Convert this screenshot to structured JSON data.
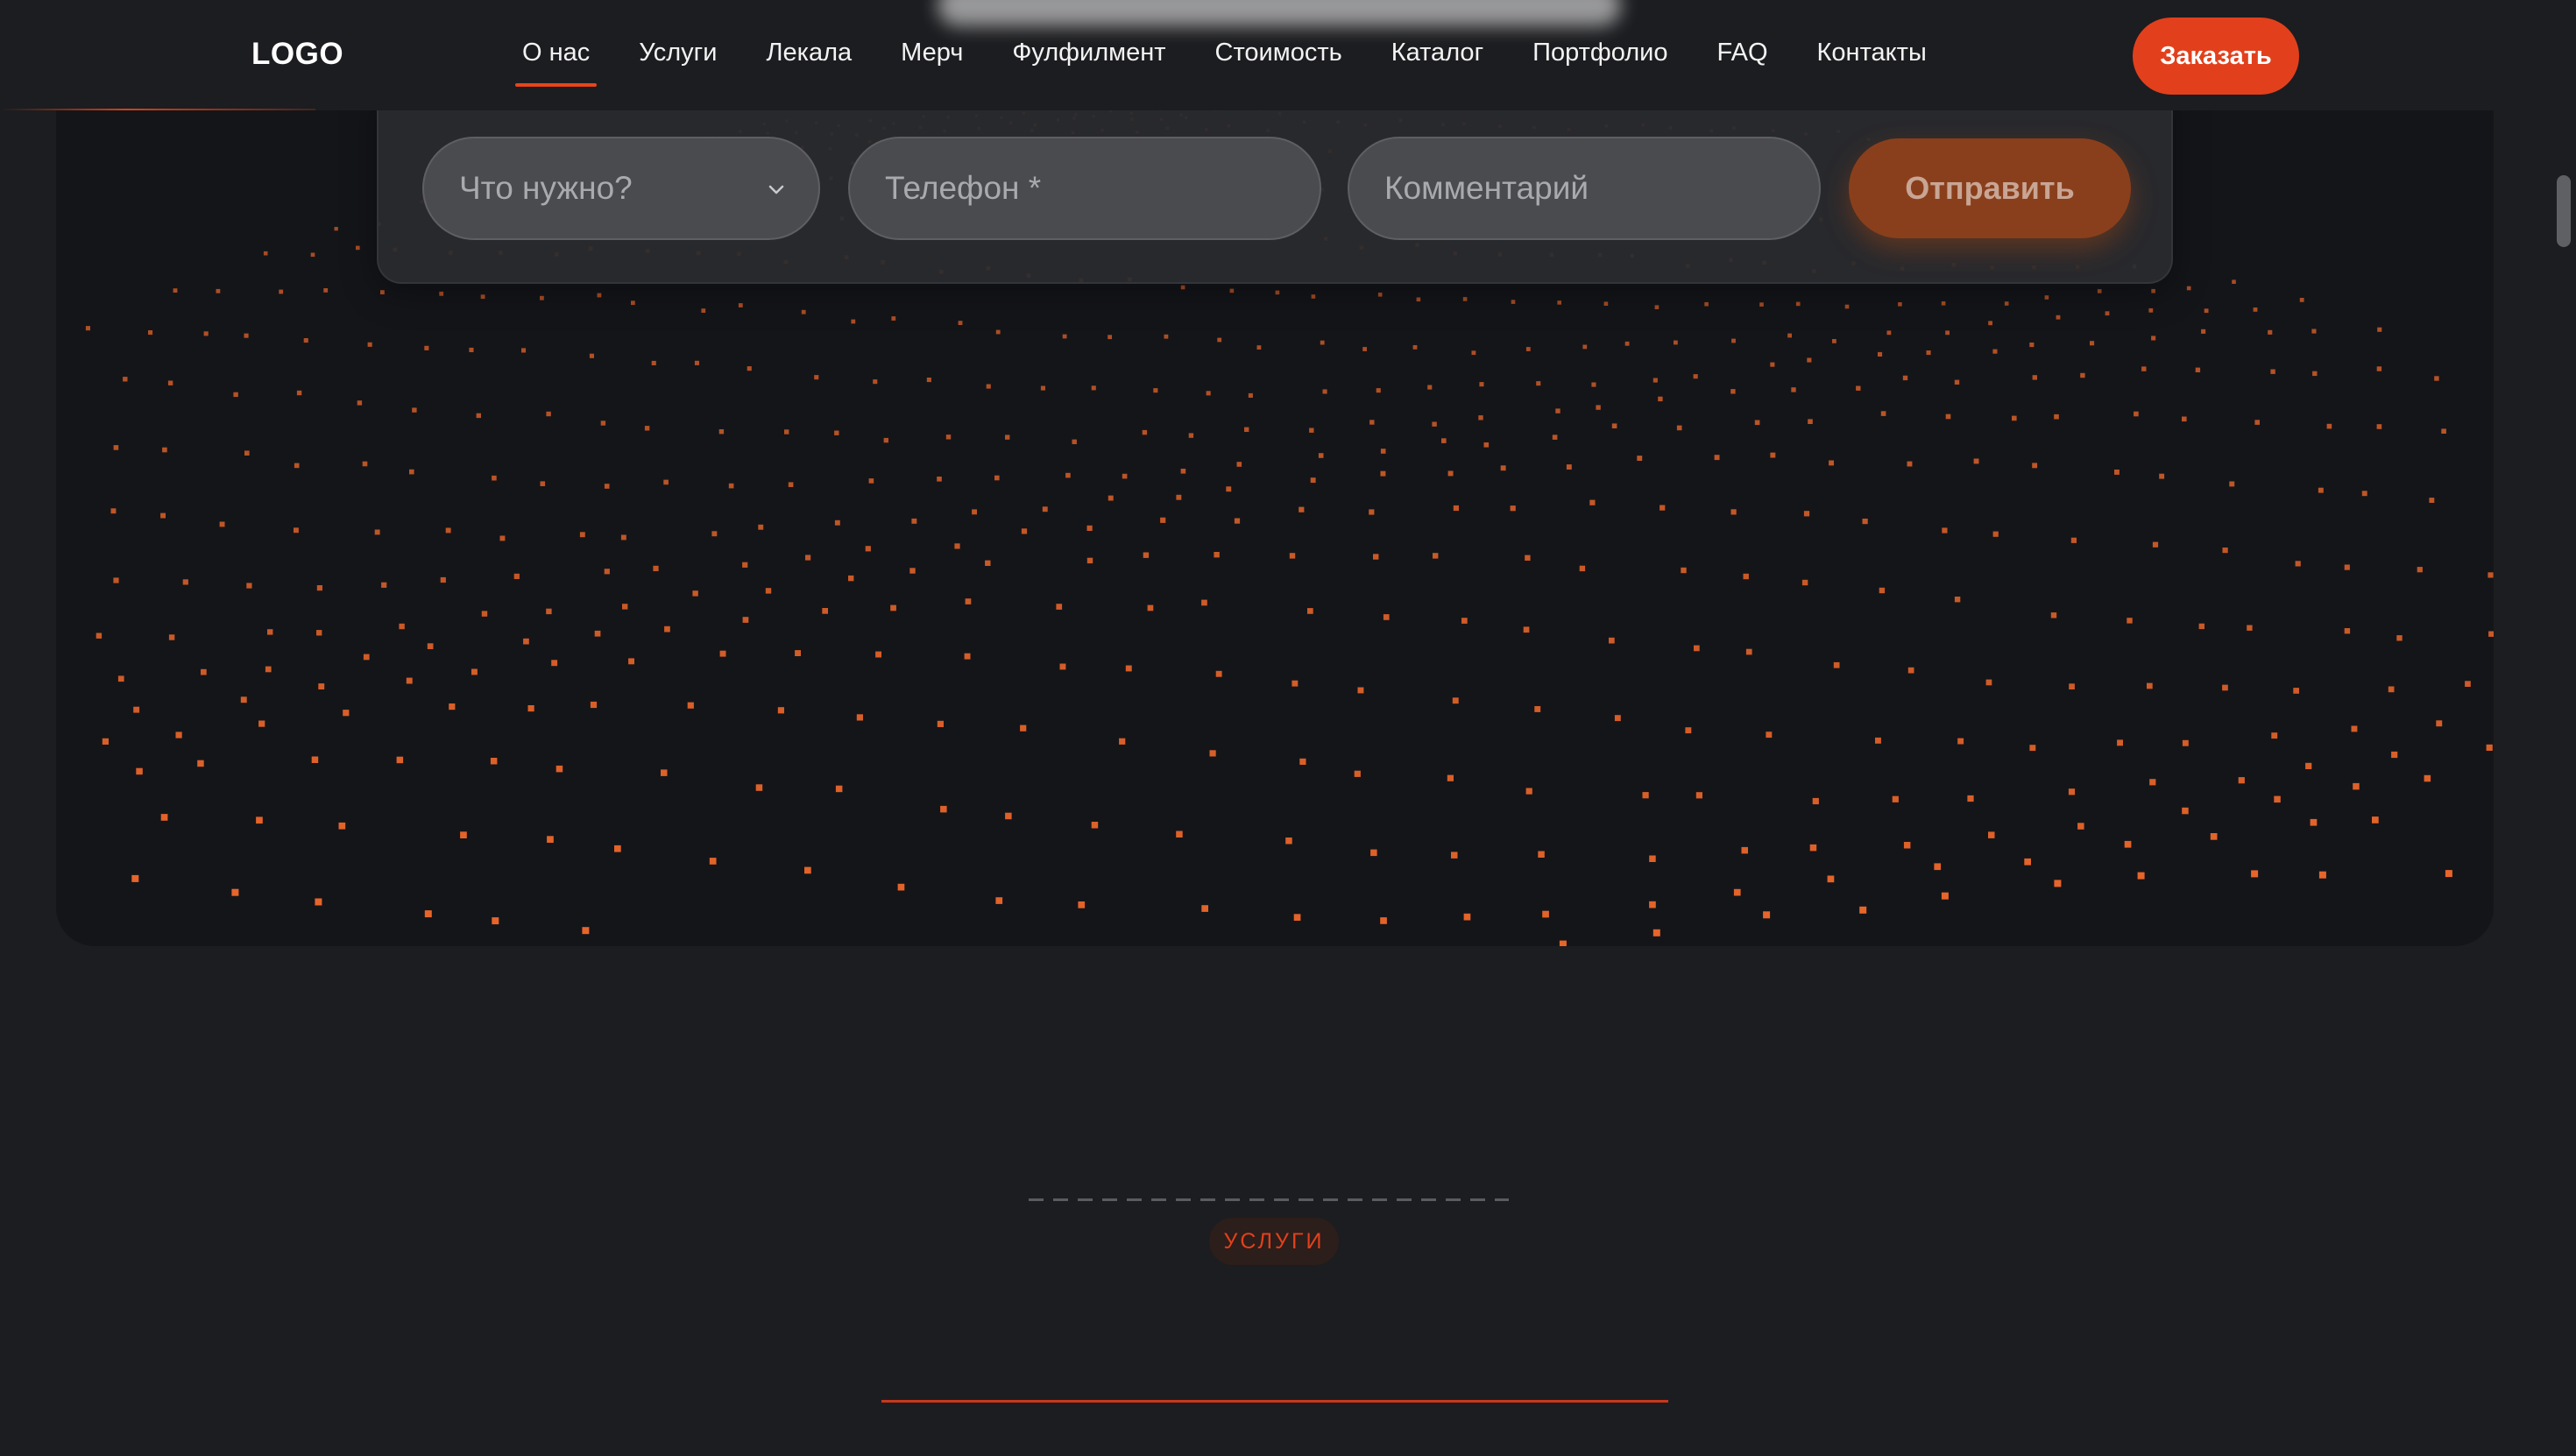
{
  "header": {
    "logo": "LOGO",
    "nav": [
      {
        "label": "О нас",
        "active": true
      },
      {
        "label": "Услуги"
      },
      {
        "label": "Лекала"
      },
      {
        "label": "Мерч"
      },
      {
        "label": "Фулфилмент"
      },
      {
        "label": "Стоимость"
      },
      {
        "label": "Каталог"
      },
      {
        "label": "Портфолио"
      },
      {
        "label": "FAQ"
      },
      {
        "label": "Контакты"
      }
    ],
    "order_button": "Заказать"
  },
  "form": {
    "select_placeholder": "Что нужно?",
    "phone_placeholder": "Телефон *",
    "comment_placeholder": "Комментарий",
    "submit_label": "Отправить"
  },
  "services": {
    "badge": "УСЛУГИ"
  },
  "colors": {
    "accent": "#e2401c",
    "background": "#1c1d20",
    "panel": "#141519",
    "dot": "#e8652a"
  }
}
